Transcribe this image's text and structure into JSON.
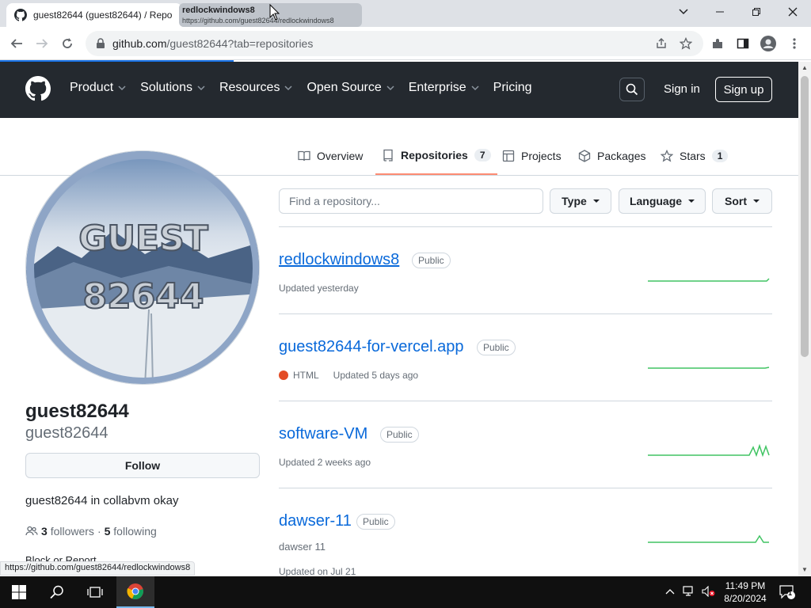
{
  "browser": {
    "tab_title": "guest82644 (guest82644) / Repo",
    "hover_tip": {
      "title": "redlockwindows8",
      "url": "https://github.com/guest82644/redlockwindows8"
    },
    "url_host": "github.com",
    "url_path": "/guest82644?tab=repositories",
    "status_url": "https://github.com/guest82644/redlockwindows8"
  },
  "header": {
    "nav": [
      "Product",
      "Solutions",
      "Resources",
      "Open Source",
      "Enterprise",
      "Pricing"
    ],
    "sign_in": "Sign in",
    "sign_up": "Sign up"
  },
  "profile_tabs": {
    "overview": "Overview",
    "repositories": "Repositories",
    "repositories_count": "7",
    "projects": "Projects",
    "packages": "Packages",
    "stars": "Stars",
    "stars_count": "1"
  },
  "avatar": {
    "line1": "GUEST",
    "line2": "82644"
  },
  "profile": {
    "full_name": "guest82644",
    "username": "guest82644",
    "follow_label": "Follow",
    "bio": "guest82644 in collabvm okay",
    "followers_count": "3",
    "followers_label": "followers",
    "following_count": "5",
    "following_label": "following",
    "block_report": "Block or Report"
  },
  "filters": {
    "search_placeholder": "Find a repository...",
    "type": "Type",
    "language": "Language",
    "sort": "Sort"
  },
  "repos": [
    {
      "name": "redlockwindows8",
      "visibility": "Public",
      "updated": "Updated yesterday"
    },
    {
      "name": "guest82644-for-vercel.app",
      "visibility": "Public",
      "language": "HTML",
      "updated": "Updated 5 days ago"
    },
    {
      "name": "software-VM",
      "visibility": "Public",
      "updated": "Updated 2 weeks ago"
    },
    {
      "name": "dawser-11",
      "visibility": "Public",
      "description": "dawser 11",
      "updated": "Updated on Jul 21"
    }
  ],
  "taskbar": {
    "time": "11:49 PM",
    "date": "8/20/2024",
    "notification_count": "1"
  },
  "colors": {
    "header_bg": "#24292f",
    "link": "#0969da",
    "active_tab_underline": "#fd8c73",
    "sparkline": "#40c463",
    "html_lang": "#e34c26"
  }
}
